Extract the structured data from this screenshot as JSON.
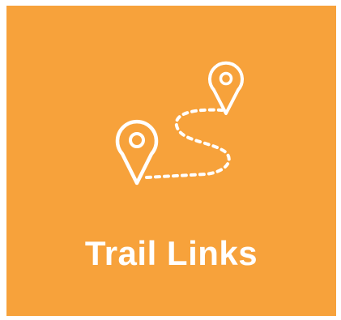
{
  "tile": {
    "label": "Trail Links",
    "background_color": "#f7a23b",
    "text_color": "#ffffff",
    "icon": "map-trail-icon"
  }
}
